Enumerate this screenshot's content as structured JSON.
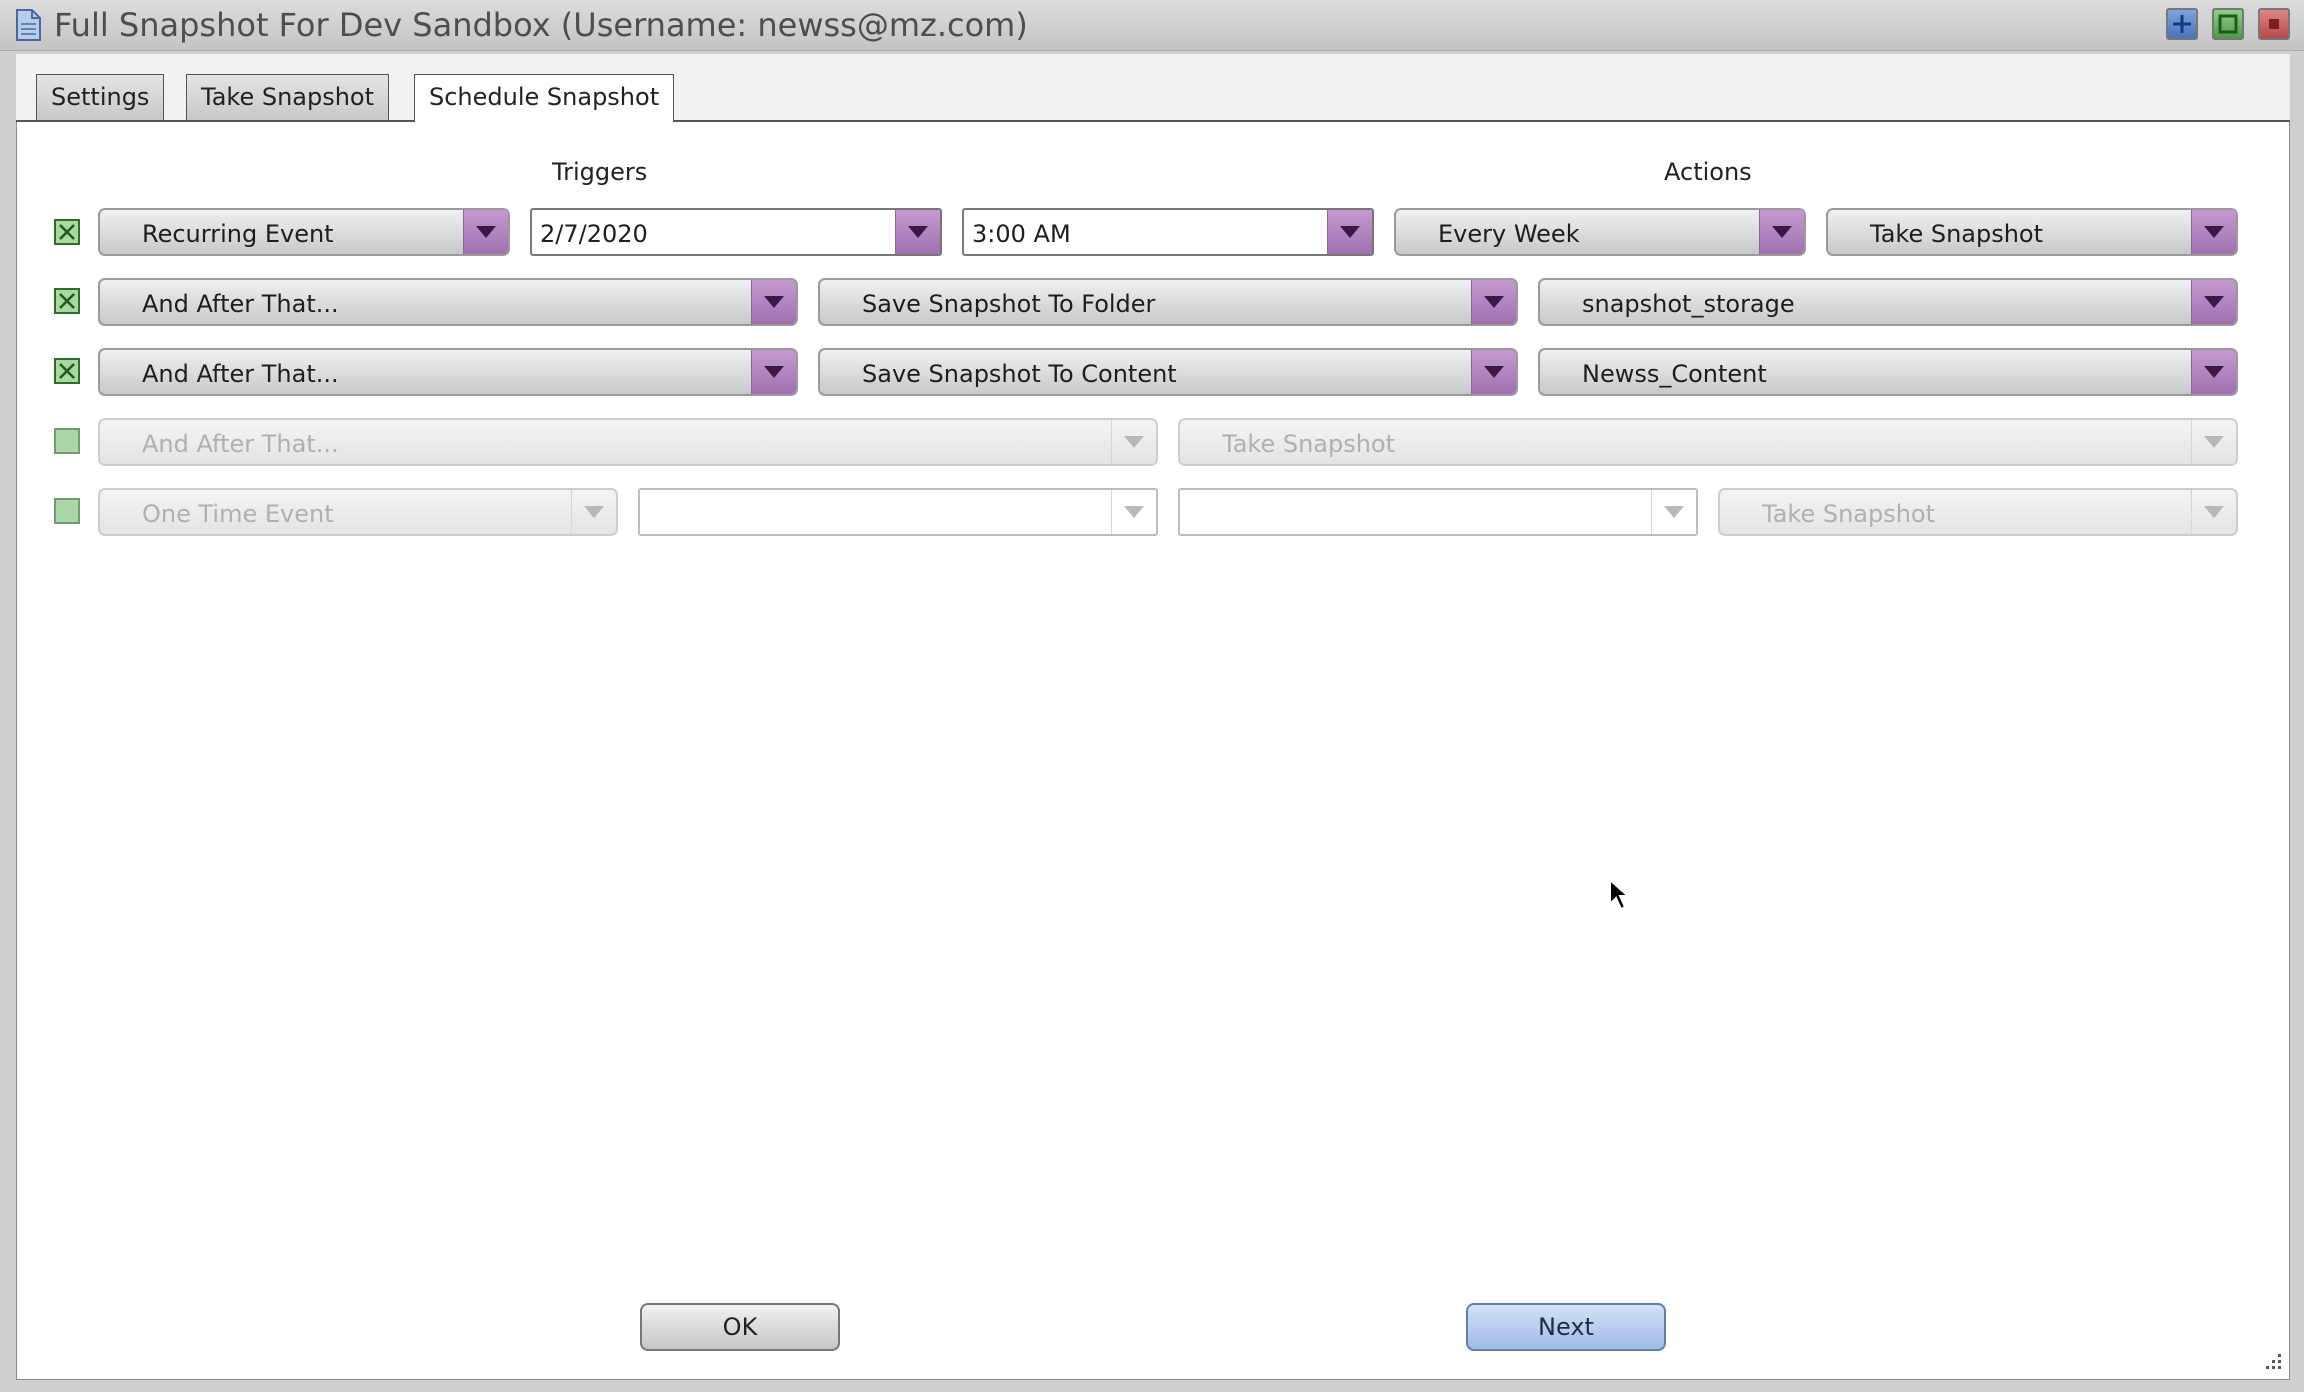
{
  "window": {
    "title": "Full Snapshot For Dev Sandbox (Username: newss@mz.com)",
    "icons": [
      "document-icon",
      "add-icon",
      "maximize-icon",
      "close-icon"
    ]
  },
  "tabs": [
    {
      "label": "Settings",
      "active": false
    },
    {
      "label": "Take Snapshot",
      "active": false
    },
    {
      "label": "Schedule Snapshot",
      "active": true
    }
  ],
  "columns": {
    "triggers": "Triggers",
    "actions": "Actions"
  },
  "rows": [
    {
      "enabled": true,
      "trigger": "Recurring Event",
      "date": "2/7/2020",
      "time": "3:00 AM",
      "frequency": "Every Week",
      "action": "Take Snapshot"
    },
    {
      "enabled": true,
      "trigger": "And After That...",
      "action": "Save Snapshot To Folder",
      "target": "snapshot_storage"
    },
    {
      "enabled": true,
      "trigger": "And After That...",
      "action": "Save Snapshot To Content",
      "target": "Newss_Content"
    },
    {
      "enabled": false,
      "trigger": "And After That...",
      "action": "Take Snapshot"
    },
    {
      "enabled": false,
      "trigger": "One Time Event",
      "date": "",
      "time": "",
      "action": "Take Snapshot"
    }
  ],
  "buttons": {
    "ok": "OK",
    "next": "Next"
  },
  "colors": {
    "dropdown_arrow": "#a070b0",
    "checkbox": "#a8d8a0",
    "next_button": "#9fbbe6"
  }
}
